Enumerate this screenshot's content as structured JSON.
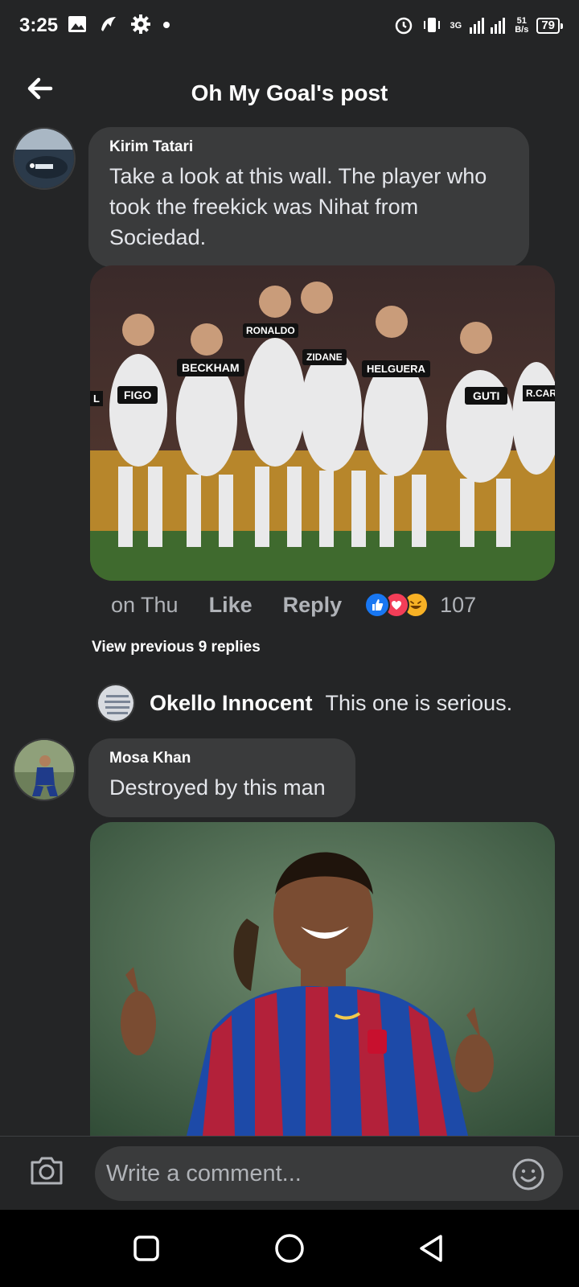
{
  "status_bar": {
    "time": "3:25",
    "network": "3G",
    "speed": "51\nB/s",
    "battery": "79"
  },
  "header": {
    "title": "Oh My Goal's post"
  },
  "comments": [
    {
      "author": "Kirim Tatari",
      "text": "Take a look at this wall. The player who took the freekick was Nihat from Sociedad.",
      "time": "on Thu",
      "like_label": "Like",
      "reply_label": "Reply",
      "reaction_count": "107",
      "reactions": [
        "like-icon",
        "love-icon",
        "haha-icon"
      ],
      "photo_labels": [
        "L",
        "FIGO",
        "BECKHAM",
        "RONALDO",
        "ZIDANE",
        "HELGUERA",
        "GUTI",
        "R.CAR"
      ]
    },
    {
      "author": "Mosa Khan",
      "text": "Destroyed by this man"
    }
  ],
  "view_previous": "View previous 9 replies",
  "reply": {
    "author": "Okello Innocent",
    "text": "This one is serious."
  },
  "composer": {
    "placeholder": "Write a comment..."
  },
  "colors": {
    "background": "#242526",
    "bubble": "#3a3b3c",
    "like_blue": "#1877f2",
    "love_red": "#f33e58",
    "haha_yellow": "#f7b125"
  }
}
